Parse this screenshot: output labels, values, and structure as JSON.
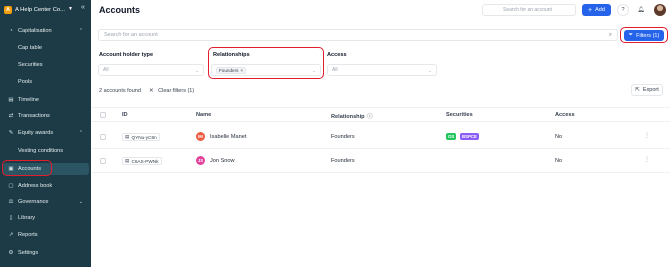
{
  "sidebar": {
    "org_initial": "A",
    "org_name": "A Help Center Co...",
    "items": [
      {
        "label": "Capitalisation",
        "icon": "pie-chart-icon"
      },
      {
        "label": "Cap table"
      },
      {
        "label": "Securities"
      },
      {
        "label": "Pools"
      },
      {
        "label": "Timeline",
        "icon": "calendar-icon"
      },
      {
        "label": "Transactions",
        "icon": "transactions-icon"
      },
      {
        "label": "Equity awards",
        "icon": "award-icon"
      },
      {
        "label": "Vesting conditions"
      },
      {
        "label": "Accounts",
        "icon": "accounts-icon"
      },
      {
        "label": "Address book",
        "icon": "address-book-icon"
      },
      {
        "label": "Governance",
        "icon": "governance-icon"
      },
      {
        "label": "Library",
        "icon": "library-icon"
      },
      {
        "label": "Reports",
        "icon": "reports-icon"
      },
      {
        "label": "Settings",
        "icon": "gear-icon"
      }
    ]
  },
  "header": {
    "title": "Accounts",
    "search_placeholder": "Search for an account",
    "add_label": "Add"
  },
  "search": {
    "placeholder": "Search for an account"
  },
  "filters_button": "Filters (1)",
  "filters": {
    "holder_type": {
      "label": "Account holder type",
      "value": "All"
    },
    "relationships": {
      "label": "Relationships",
      "tag": "Founders"
    },
    "access": {
      "label": "Access",
      "value": "All"
    }
  },
  "results": {
    "count": "2 accounts found",
    "clear": "Clear filters (1)",
    "export": "Export"
  },
  "table": {
    "columns": [
      "ID",
      "Name",
      "Relationship",
      "Securities",
      "Access"
    ],
    "rows": [
      {
        "id": "QYNu-yC8n",
        "initials": "IM",
        "name": "Isabelle Manet",
        "relationship": "Founders",
        "securities": [
          "OS",
          "BSPCE"
        ],
        "access": "No"
      },
      {
        "id": "C6AS-PWNk",
        "initials": "JS",
        "name": "Jon Snow",
        "relationship": "Founders",
        "securities": [],
        "access": "No"
      }
    ]
  },
  "colors": {
    "sidebar_bg": "#1c3b46",
    "accent": "#2563eb",
    "highlight": "#e11d2e",
    "badge_os": "#22c55e",
    "badge_bspce": "#8b5cf6",
    "avatar_im": "#ef5b41",
    "avatar_js": "#e0409a"
  }
}
